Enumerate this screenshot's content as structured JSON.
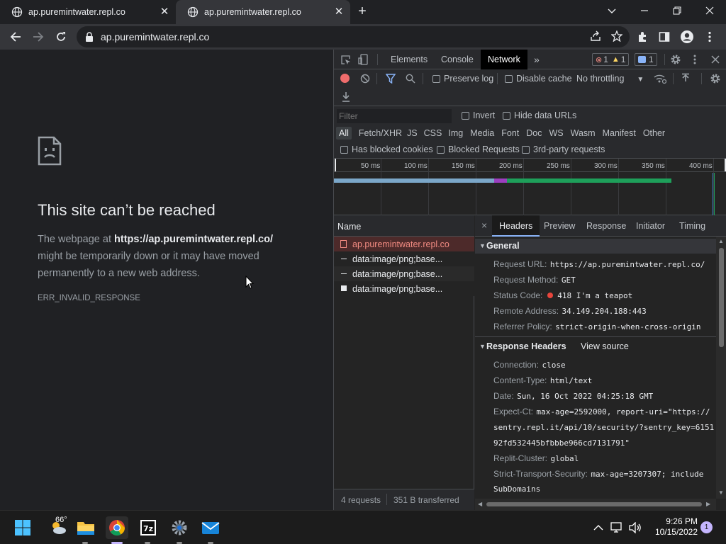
{
  "tabs": [
    {
      "title": "ap.puremintwater.repl.co"
    },
    {
      "title": "ap.puremintwater.repl.co"
    }
  ],
  "omnibox": {
    "url": "ap.puremintwater.repl.co"
  },
  "error_page": {
    "title": "This site can’t be reached",
    "body_prefix": "The webpage at ",
    "body_url": "https://ap.puremintwater.repl.co/",
    "body_suffix": " might be temporarily down or it may have moved permanently to a new web address.",
    "code": "ERR_INVALID_RESPONSE"
  },
  "devtools": {
    "tabs": [
      "Elements",
      "Console",
      "Network"
    ],
    "errors_count": "1",
    "warnings_count": "1",
    "messages_count": "1",
    "toolbar": {
      "preserve_log": "Preserve log",
      "disable_cache": "Disable cache",
      "throttling": "No throttling"
    },
    "filter": {
      "placeholder": "Filter",
      "invert": "Invert",
      "hide_data_urls": "Hide data URLs",
      "types": [
        "All",
        "Fetch/XHR",
        "JS",
        "CSS",
        "Img",
        "Media",
        "Font",
        "Doc",
        "WS",
        "Wasm",
        "Manifest",
        "Other"
      ],
      "blocked_cookies": "Has blocked cookies",
      "blocked_requests": "Blocked Requests",
      "third_party": "3rd-party requests"
    },
    "timeline": {
      "ticks": [
        "50 ms",
        "100 ms",
        "150 ms",
        "200 ms",
        "250 ms",
        "300 ms",
        "350 ms",
        "400 ms"
      ]
    },
    "name_header": "Name",
    "requests": [
      {
        "name": "ap.puremintwater.repl.co",
        "error": true
      },
      {
        "name": "data:image/png;base...",
        "error": false
      },
      {
        "name": "data:image/png;base...",
        "error": false
      },
      {
        "name": "data:image/png;base...",
        "error": false
      }
    ],
    "status_bar": {
      "requests": "4 requests",
      "transferred": "351 B transferred"
    },
    "detail_tabs": [
      "Headers",
      "Preview",
      "Response",
      "Initiator",
      "Timing"
    ],
    "general": {
      "title": "General",
      "rows": [
        {
          "label": "Request URL:",
          "value": "https://ap.puremintwater.repl.co/"
        },
        {
          "label": "Request Method:",
          "value": "GET"
        },
        {
          "label": "Status Code:",
          "value": "418 I'm a teapot"
        },
        {
          "label": "Remote Address:",
          "value": "34.149.204.188:443"
        },
        {
          "label": "Referrer Policy:",
          "value": "strict-origin-when-cross-origin"
        }
      ]
    },
    "response_headers": {
      "title": "Response Headers",
      "view_source": "View source",
      "rows": [
        {
          "label": "Connection:",
          "value": "close"
        },
        {
          "label": "Content-Type:",
          "value": "html/text"
        },
        {
          "label": "Date:",
          "value": "Sun, 16 Oct 2022 04:25:18 GMT"
        },
        {
          "label": "Expect-Ct:",
          "value": "max-age=2592000, report-uri=\"https://"
        },
        {
          "label": "",
          "value": "sentry.repl.it/api/10/security/?sentry_key=6151"
        },
        {
          "label": "",
          "value": "92fd532445bfbbbe966cd7131791\""
        },
        {
          "label": "Replit-Cluster:",
          "value": "global"
        },
        {
          "label": "Strict-Transport-Security:",
          "value": "max-age=3207307; include"
        },
        {
          "label": "",
          "value": "SubDomains"
        }
      ]
    }
  },
  "taskbar": {
    "weather_temp": "66°",
    "time": "9:26 PM",
    "date": "10/15/2022",
    "notification_count": "1"
  },
  "colors": {
    "accent": "#8ab4f8",
    "error": "#f28b82",
    "record": "#ef6c6c",
    "timeline_blue": "#4a90c8",
    "timeline_green": "#1e9f5a",
    "timeline_purple": "#9c3fbf"
  }
}
